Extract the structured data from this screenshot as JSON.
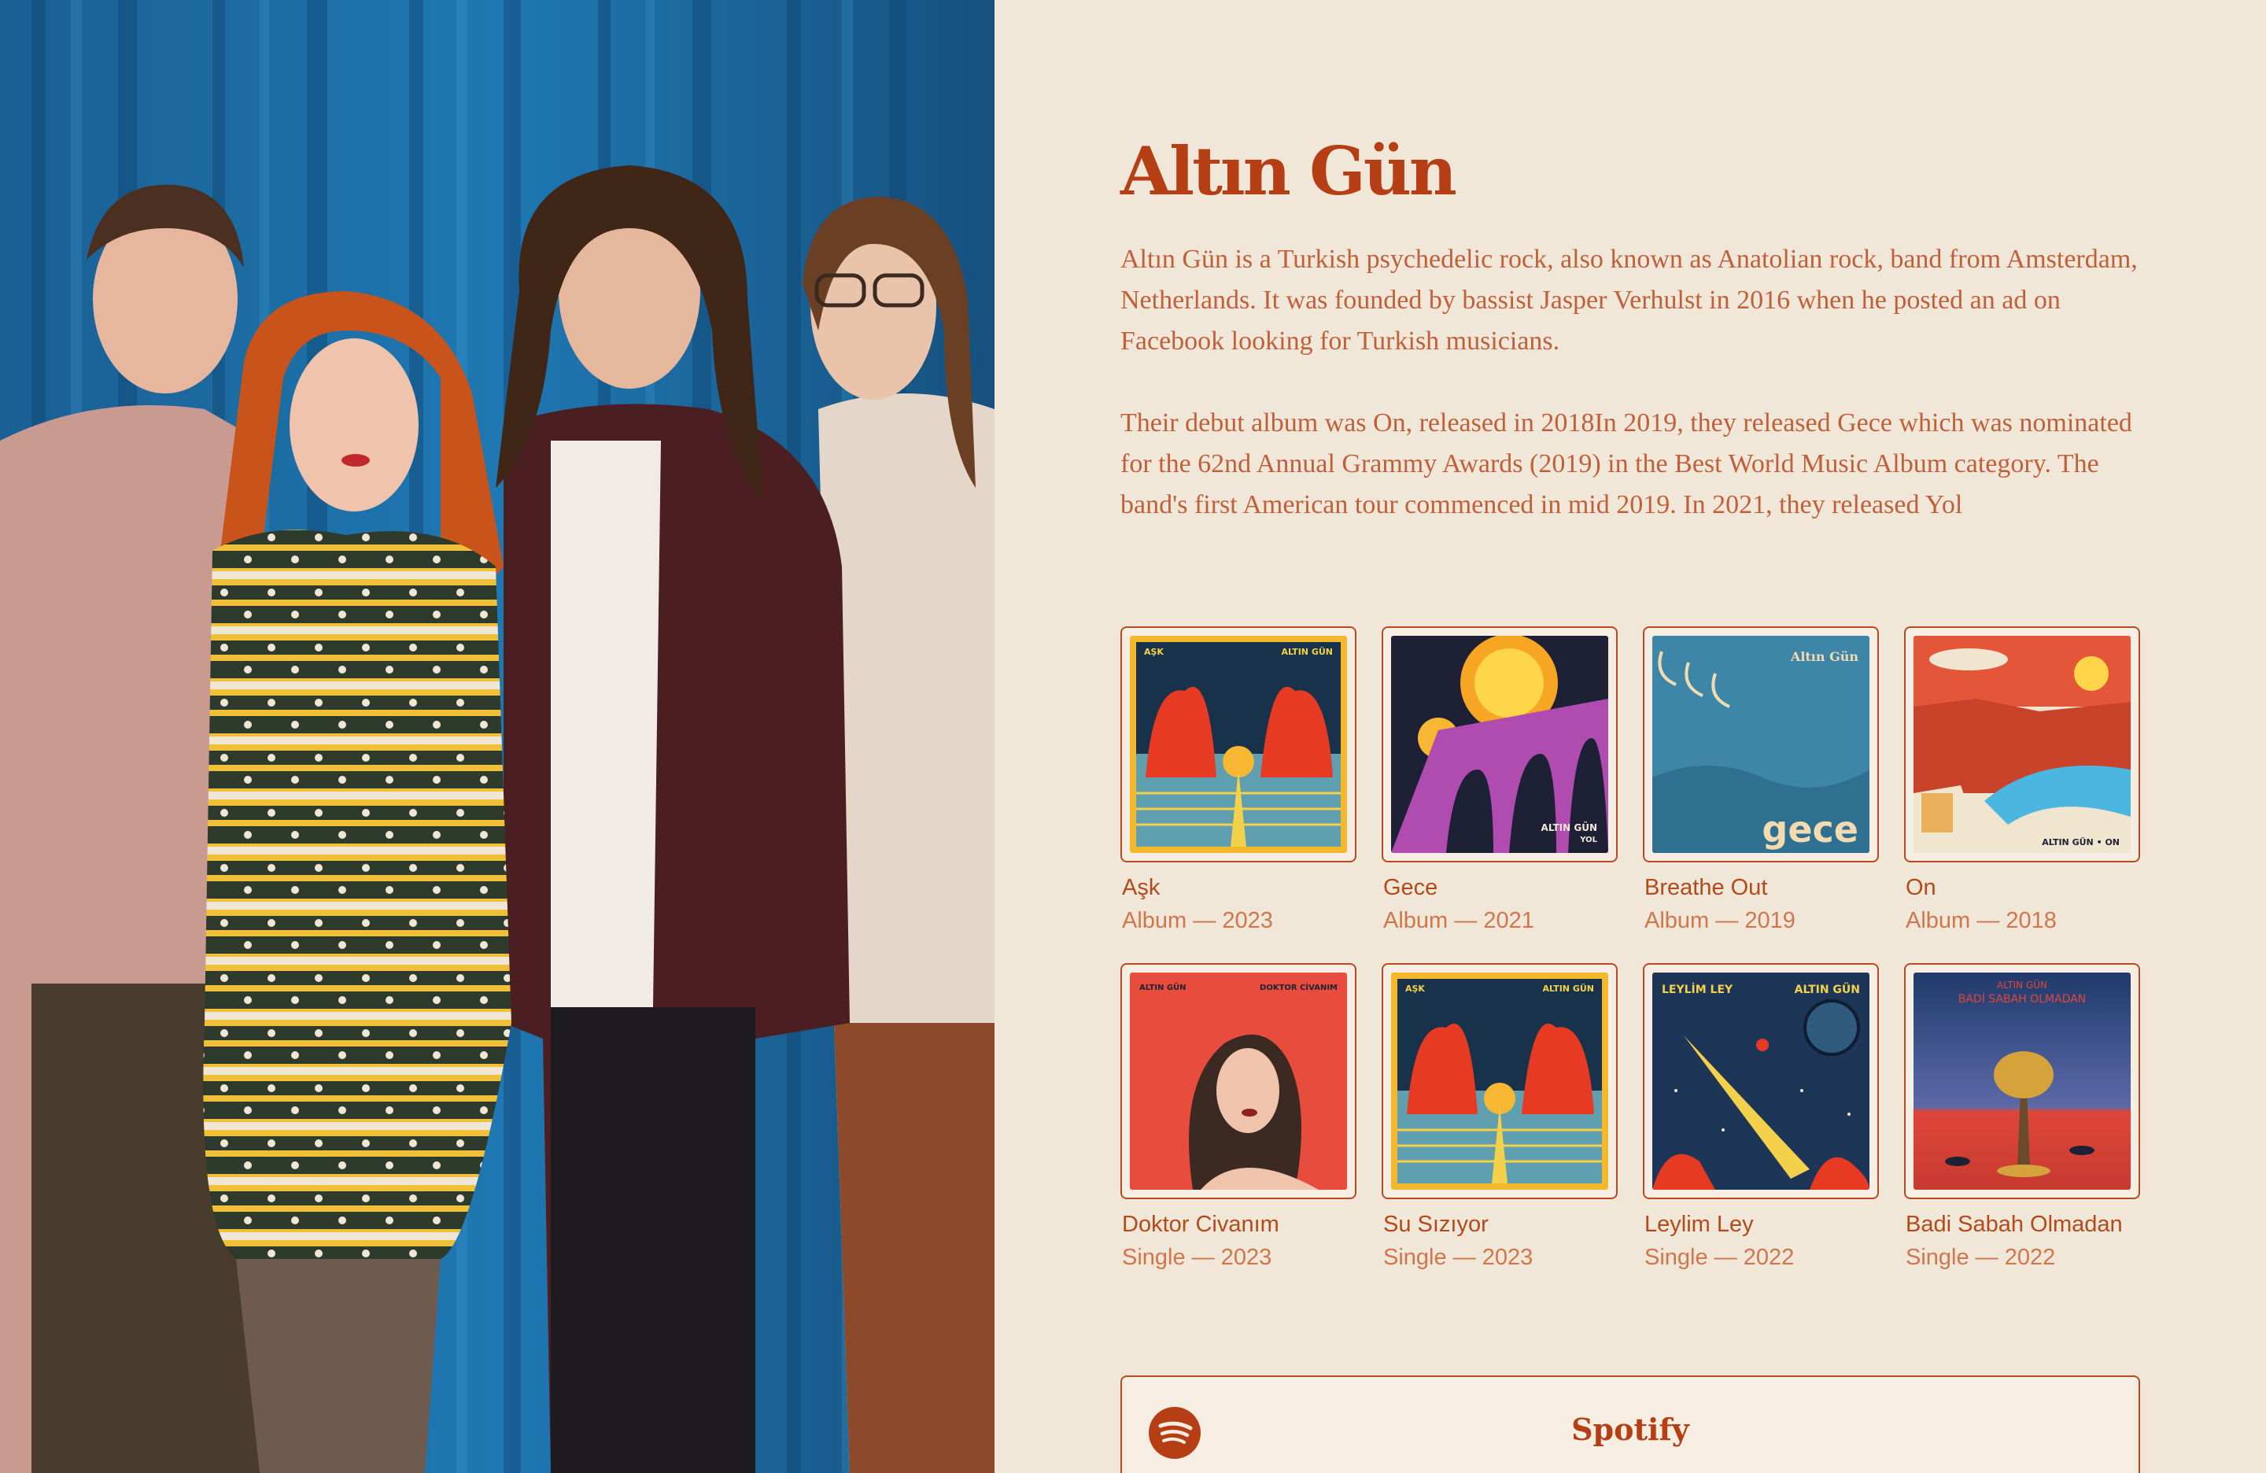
{
  "artist": {
    "name": "Altın Gün",
    "bio_paragraph_1": "Altın Gün is a Turkish psychedelic rock, also known as Anatolian rock, band from Amsterdam, Netherlands. It was founded by bassist Jasper Verhulst in 2016 when he posted an ad on Facebook looking for Turkish musicians.",
    "bio_paragraph_2": "Their debut album was On, released in 2018In 2019, they released Gece which was nominated for the 62nd Annual Grammy Awards (2019) in the Best World Music Album category. The band's first American tour commenced in mid 2019. In 2021, they released Yol"
  },
  "releases": [
    {
      "title": "Aşk",
      "meta": "Album — 2023",
      "cover_text": [
        "AŞK",
        "ALTIN GÜN"
      ]
    },
    {
      "title": "Gece",
      "meta": "Album — 2021",
      "cover_text": [
        "ALTIN GÜN",
        "YOL"
      ]
    },
    {
      "title": "Breathe Out",
      "meta": "Album — 2019",
      "cover_text": [
        "Altın Gün",
        "gece"
      ]
    },
    {
      "title": "On",
      "meta": "Album — 2018",
      "cover_text": [
        "ALTIN GÜN • ON"
      ]
    },
    {
      "title": "Doktor Civanım",
      "meta": "Single — 2023",
      "cover_text": [
        "ALTIN GÜN",
        "DOKTOR CİVANIM"
      ]
    },
    {
      "title": "Su Sızıyor",
      "meta": "Single — 2023",
      "cover_text": [
        "AŞK",
        "ALTIN GÜN"
      ]
    },
    {
      "title": "Leylim Ley",
      "meta": "Single — 2022",
      "cover_text": [
        "LEYLİM LEY",
        "ALTIN GÜN"
      ]
    },
    {
      "title": "Badi Sabah Olmadan",
      "meta": "Single — 2022",
      "cover_text": [
        "ALTIN GÜN",
        "BADİ SABAH OLMADAN"
      ]
    }
  ],
  "streaming": {
    "label": "Spotify",
    "icon": "spotify-icon"
  },
  "colors": {
    "background": "#f1e7d8",
    "accent": "#b53e14",
    "text_muted": "#c0603a",
    "curtain": "#1b6fa8"
  }
}
